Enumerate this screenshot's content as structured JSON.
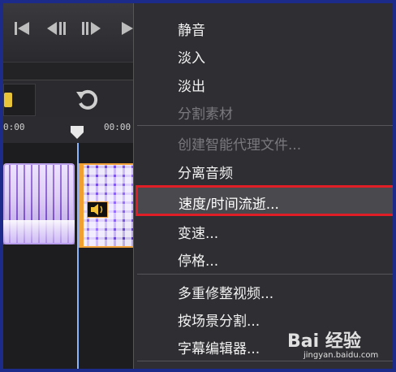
{
  "timeline": {
    "ruler_ticks": [
      "0:00",
      "00:00"
    ]
  },
  "context_menu": {
    "items": [
      {
        "label": "静音",
        "enabled": true
      },
      {
        "label": "淡入",
        "enabled": true
      },
      {
        "label": "淡出",
        "enabled": true
      },
      {
        "label": "分割素材",
        "enabled": false
      },
      {
        "label": "创建智能代理文件...",
        "enabled": false
      },
      {
        "label": "分离音频",
        "enabled": true
      },
      {
        "label": "速度/时间流逝...",
        "enabled": true,
        "highlighted": true
      },
      {
        "label": "变速...",
        "enabled": true
      },
      {
        "label": "停格...",
        "enabled": true
      },
      {
        "label": "多重修整视频...",
        "enabled": true
      },
      {
        "label": "按场景分割...",
        "enabled": true
      },
      {
        "label": "字幕编辑器...",
        "enabled": true
      }
    ]
  },
  "watermark": {
    "brand": "Bai 经验",
    "url": "jingyan.baidu.com"
  },
  "colors": {
    "highlight_border": "#e01e26",
    "clip_selection": "#f2a23a",
    "frame_border": "#1c2a8a"
  }
}
